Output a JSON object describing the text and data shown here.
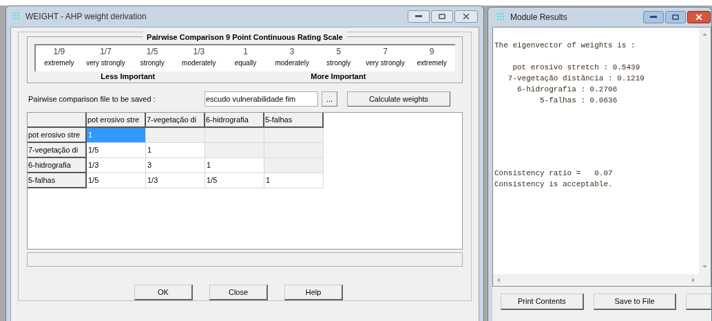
{
  "dialog": {
    "title": "WEIGHT - AHP weight derivation",
    "scale": {
      "title": "Pairwise Comparison 9 Point Continuous Rating Scale",
      "points": [
        {
          "value": "1/9",
          "label": "extremely"
        },
        {
          "value": "1/7",
          "label": "very strongly"
        },
        {
          "value": "1/5",
          "label": "strongly"
        },
        {
          "value": "1/3",
          "label": "moderately"
        },
        {
          "value": "1",
          "label": "equally"
        },
        {
          "value": "3",
          "label": "moderately"
        },
        {
          "value": "5",
          "label": "strongly"
        },
        {
          "value": "7",
          "label": "very strongly"
        },
        {
          "value": "9",
          "label": "extremely"
        }
      ],
      "left_caption": "Less Important",
      "right_caption": "More Important"
    },
    "file_label": "Pairwise comparison file to be saved :",
    "file_field": {
      "value": "escudo vulnerabilidade fim"
    },
    "browse_button": "...",
    "calculate_button": "Calculate weights",
    "matrix": {
      "columns": [
        "pot erosivo stre",
        "7-vegetação di",
        "6-hidrografia",
        "5-falhas"
      ],
      "rows": [
        {
          "header": "pot erosivo stre",
          "cells": [
            {
              "text": "1",
              "selected": true
            }
          ]
        },
        {
          "header": "7-vegetação di",
          "cells": [
            {
              "text": "1/5",
              "selected": false
            },
            {
              "text": "1",
              "selected": false
            }
          ]
        },
        {
          "header": "6-hidrografia",
          "cells": [
            {
              "text": "1/3",
              "selected": false
            },
            {
              "text": "3",
              "selected": false
            },
            {
              "text": "1",
              "selected": false
            }
          ]
        },
        {
          "header": "5-falhas",
          "cells": [
            {
              "text": "1/5",
              "selected": false
            },
            {
              "text": "1/3",
              "selected": false
            },
            {
              "text": "1/5",
              "selected": false
            },
            {
              "text": "1",
              "selected": false
            }
          ]
        }
      ]
    },
    "buttons": [
      "OK",
      "Close",
      "Help"
    ]
  },
  "results": {
    "title": "Module Results",
    "heading": "The eigenvector of weights is :",
    "weights": [
      "    pot erosivo stretch : 0.5439",
      "   7-vegetação distância : 0.1219",
      "     6-hidrografia : 0.2706",
      "          5-falhas : 0.0636"
    ],
    "consistency": [
      "Consistency ratio =   0.07",
      "Consistency is acceptable."
    ],
    "buttons": [
      "Print Contents",
      "Save to File"
    ]
  }
}
